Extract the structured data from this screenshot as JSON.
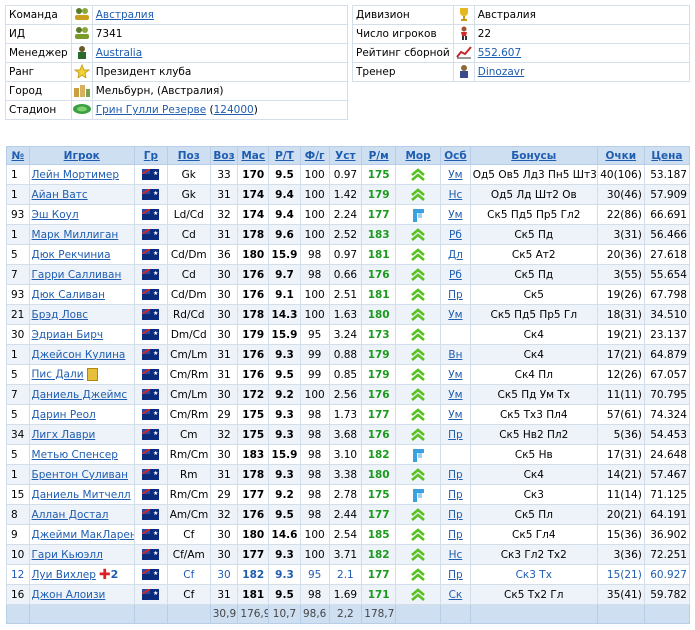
{
  "team_info": {
    "left": [
      {
        "label": "Команда",
        "value": "Австралия",
        "link": true,
        "icon": "team-icon"
      },
      {
        "label": "ИД",
        "value": "7341",
        "link": false,
        "icon": "id-icon"
      },
      {
        "label": "Менеджер",
        "value": "Australia",
        "link": true,
        "icon": "manager-icon"
      },
      {
        "label": "Ранг",
        "value": "Президент клуба",
        "link": false,
        "icon": "star-icon"
      },
      {
        "label": "Город",
        "value": "Мельбурн, (Австралия)",
        "link": false,
        "icon": "city-icon"
      },
      {
        "label": "Стадион",
        "value": "Грин Гулли Резерве",
        "link": true,
        "icon": "stadium-icon",
        "extra": "124000"
      }
    ],
    "right": [
      {
        "label": "Дивизион",
        "value": "Австралия",
        "link": false,
        "icon": "trophy-icon"
      },
      {
        "label": "Число игроков",
        "value": "22",
        "link": false,
        "icon": "player-icon"
      },
      {
        "label": "Рейтинг сборной",
        "value": "552.607",
        "link": true,
        "icon": "rating-chart-icon"
      },
      {
        "label": "Тренер",
        "value": "Dinozavr",
        "link": true,
        "icon": "coach-icon"
      }
    ]
  },
  "players_table": {
    "headers": [
      "№",
      "Игрок",
      "Гр",
      "Поз",
      "Воз",
      "Мас",
      "Р/Т",
      "Ф/г",
      "Уст",
      "Р/м",
      "Мор",
      "Осб",
      "Бонусы",
      "Очки",
      "Цена"
    ],
    "rows": [
      {
        "no": "1",
        "name": "Лейн Мортимер",
        "pos": "Gk",
        "age": "33",
        "mas": "170",
        "rt": "9.5",
        "fg": "100",
        "ust": "0.97",
        "rm": "175",
        "mor": "up",
        "osb": "Ум",
        "bonus": "Од5 Ов5 Лд3 Пн5 Шт3",
        "pts": "40(106)",
        "price": "53.187"
      },
      {
        "no": "1",
        "name": "Айан Ватс",
        "pos": "Gk",
        "age": "31",
        "mas": "174",
        "rt": "9.4",
        "fg": "100",
        "ust": "1.42",
        "rm": "179",
        "mor": "up",
        "osb": "Нс",
        "bonus": "Од5 Лд Шт2 Ов",
        "pts": "30(46)",
        "price": "57.909"
      },
      {
        "no": "93",
        "name": "Эш Коул",
        "pos": "Ld/Cd",
        "age": "32",
        "mas": "174",
        "rt": "9.4",
        "fg": "100",
        "ust": "2.24",
        "rm": "177",
        "mor": "flag",
        "osb": "Ум",
        "bonus": "Ск5 Пд5 Пр5 Гл2",
        "pts": "22(86)",
        "price": "66.691"
      },
      {
        "no": "1",
        "name": "Марк Миллиган",
        "pos": "Cd",
        "age": "31",
        "mas": "178",
        "rt": "9.6",
        "fg": "100",
        "ust": "2.52",
        "rm": "183",
        "mor": "up",
        "osb": "Рб",
        "bonus": "Ск5 Пд",
        "pts": "3(31)",
        "price": "56.466"
      },
      {
        "no": "5",
        "name": "Дюк Рекчиниа",
        "pos": "Cd/Dm",
        "age": "36",
        "mas": "180",
        "rt": "15.9",
        "fg": "98",
        "ust": "0.97",
        "rm": "181",
        "mor": "up",
        "osb": "Дл",
        "bonus": "Ск5 Ат2",
        "pts": "20(36)",
        "price": "27.618"
      },
      {
        "no": "7",
        "name": "Гарри Салливан",
        "pos": "Cd",
        "age": "30",
        "mas": "176",
        "rt": "9.7",
        "fg": "98",
        "ust": "0.66",
        "rm": "176",
        "mor": "up",
        "osb": "Рб",
        "bonus": "Ск5 Пд",
        "pts": "3(55)",
        "price": "55.654"
      },
      {
        "no": "93",
        "name": "Дюк Саливан",
        "pos": "Cd/Dm",
        "age": "30",
        "mas": "176",
        "rt": "9.1",
        "fg": "100",
        "ust": "2.51",
        "rm": "181",
        "mor": "up",
        "osb": "Пр",
        "bonus": "Ск5",
        "pts": "19(26)",
        "price": "67.798"
      },
      {
        "no": "21",
        "name": "Брэд Ловс",
        "pos": "Rd/Cd",
        "age": "30",
        "mas": "178",
        "rt": "14.3",
        "fg": "100",
        "ust": "1.63",
        "rm": "180",
        "mor": "up",
        "osb": "Ум",
        "bonus": "Ск5 Пд5 Пр5 Гл",
        "pts": "18(31)",
        "price": "34.510"
      },
      {
        "no": "30",
        "name": "Эдриан Бирч",
        "pos": "Dm/Cd",
        "age": "30",
        "mas": "179",
        "rt": "15.9",
        "fg": "95",
        "ust": "3.24",
        "rm": "173",
        "mor": "up",
        "osb": "",
        "bonus": "Ск4",
        "pts": "19(21)",
        "price": "23.137"
      },
      {
        "no": "1",
        "name": "Джейсон Кулина",
        "pos": "Cm/Lm",
        "age": "31",
        "mas": "176",
        "rt": "9.3",
        "fg": "99",
        "ust": "0.88",
        "rm": "179",
        "mor": "up",
        "osb": "Вн",
        "bonus": "Ск4",
        "pts": "17(21)",
        "price": "64.879"
      },
      {
        "no": "5",
        "name": "Пис Дали",
        "pos": "Cm/Rm",
        "age": "31",
        "mas": "176",
        "rt": "9.5",
        "fg": "99",
        "ust": "0.85",
        "rm": "179",
        "mor": "up",
        "osb": "Ум",
        "bonus": "Ск4 Пл",
        "pts": "12(26)",
        "price": "67.057",
        "card": true
      },
      {
        "no": "7",
        "name": "Даниель Джеймс",
        "pos": "Cm/Lm",
        "age": "30",
        "mas": "172",
        "rt": "9.2",
        "fg": "100",
        "ust": "2.56",
        "rm": "176",
        "mor": "up",
        "osb": "Ум",
        "bonus": "Ск5 Пд Ум Тх",
        "pts": "11(11)",
        "price": "70.795"
      },
      {
        "no": "5",
        "name": "Дарин Реол",
        "pos": "Cm/Rm",
        "age": "29",
        "mas": "175",
        "rt": "9.3",
        "fg": "98",
        "ust": "1.73",
        "rm": "177",
        "mor": "up",
        "osb": "Ум",
        "bonus": "Ск5 Тх3 Пл4",
        "pts": "57(61)",
        "price": "74.324"
      },
      {
        "no": "34",
        "name": "Лигх Лаври",
        "pos": "Cm",
        "age": "32",
        "mas": "175",
        "rt": "9.3",
        "fg": "98",
        "ust": "3.68",
        "rm": "176",
        "mor": "up",
        "osb": "Пр",
        "bonus": "Ск5 Нв2 Пл2",
        "pts": "5(36)",
        "price": "54.453"
      },
      {
        "no": "5",
        "name": "Метью Спенсер",
        "pos": "Rm/Cm",
        "age": "30",
        "mas": "183",
        "rt": "15.9",
        "fg": "98",
        "ust": "3.10",
        "rm": "182",
        "mor": "flag",
        "osb": "",
        "bonus": "Ск5 Нв",
        "pts": "17(31)",
        "price": "24.648"
      },
      {
        "no": "1",
        "name": "Брентон Суливан",
        "pos": "Rm",
        "age": "31",
        "mas": "178",
        "rt": "9.3",
        "fg": "98",
        "ust": "3.38",
        "rm": "180",
        "mor": "up",
        "osb": "Пр",
        "bonus": "Ск4",
        "pts": "14(21)",
        "price": "57.467"
      },
      {
        "no": "15",
        "name": "Даниель Митчелл",
        "pos": "Rm/Cm",
        "age": "29",
        "mas": "177",
        "rt": "9.2",
        "fg": "98",
        "ust": "2.78",
        "rm": "175",
        "mor": "flag",
        "osb": "Пр",
        "bonus": "Ск3",
        "pts": "11(14)",
        "price": "71.125"
      },
      {
        "no": "8",
        "name": "Аллан Достал",
        "pos": "Am/Cm",
        "age": "32",
        "mas": "176",
        "rt": "9.5",
        "fg": "98",
        "ust": "2.44",
        "rm": "177",
        "mor": "up",
        "osb": "Пр",
        "bonus": "Ск5 Пл",
        "pts": "20(21)",
        "price": "64.191"
      },
      {
        "no": "9",
        "name": "Джейми МакЛарен",
        "pos": "Cf",
        "age": "30",
        "mas": "180",
        "rt": "14.6",
        "fg": "100",
        "ust": "2.54",
        "rm": "185",
        "mor": "up",
        "osb": "Пр",
        "bonus": "Ск5 Гл4",
        "pts": "15(36)",
        "price": "36.902"
      },
      {
        "no": "10",
        "name": "Гари Кьюэлл",
        "pos": "Cf/Am",
        "age": "30",
        "mas": "177",
        "rt": "9.3",
        "fg": "100",
        "ust": "3.71",
        "rm": "182",
        "mor": "up",
        "osb": "Нс",
        "bonus": "Ск3 Гл2 Тх2",
        "pts": "3(36)",
        "price": "72.251"
      },
      {
        "no": "12",
        "name": "Луи Вихлер",
        "pos": "Cf",
        "age": "30",
        "mas": "182",
        "rt": "9.3",
        "fg": "95",
        "ust": "2.1",
        "rm": "177",
        "mor": "up",
        "osb": "Пр",
        "bonus": "Ск3 Тх",
        "pts": "15(21)",
        "price": "60.927",
        "blue": true,
        "injury": "2"
      },
      {
        "no": "16",
        "name": "Джон Алоизи",
        "pos": "Cf",
        "age": "31",
        "mas": "181",
        "rt": "9.5",
        "fg": "98",
        "ust": "1.69",
        "rm": "171",
        "mor": "up",
        "osb": "Ск",
        "bonus": "Ск5 Тх2 Гл",
        "pts": "35(41)",
        "price": "59.782"
      }
    ],
    "footer": [
      "",
      "",
      "",
      "",
      "30,9",
      "176,9",
      "10,7",
      "98,6",
      "2,2",
      "178,7",
      "",
      "",
      "",
      "",
      ""
    ]
  }
}
